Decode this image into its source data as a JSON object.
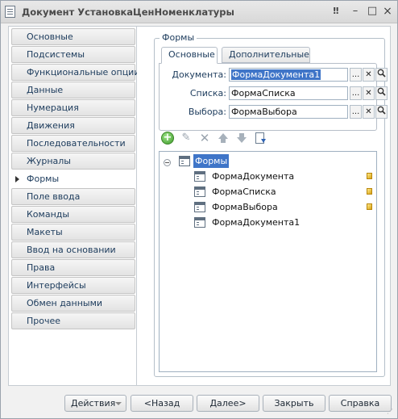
{
  "window": {
    "title": "Документ УстановкаЦенНоменклатуры",
    "buttons": [
      "‼",
      "–",
      "□",
      "×"
    ]
  },
  "sidebar": {
    "active_index": 8,
    "items": [
      {
        "label": "Основные"
      },
      {
        "label": "Подсистемы"
      },
      {
        "label": "Функциональные опции"
      },
      {
        "label": "Данные"
      },
      {
        "label": "Нумерация"
      },
      {
        "label": "Движения"
      },
      {
        "label": "Последовательности"
      },
      {
        "label": "Журналы"
      },
      {
        "label": "Формы"
      },
      {
        "label": "Поле ввода"
      },
      {
        "label": "Команды"
      },
      {
        "label": "Макеты"
      },
      {
        "label": "Ввод на основании"
      },
      {
        "label": "Права"
      },
      {
        "label": "Интерфейсы"
      },
      {
        "label": "Обмен данными"
      },
      {
        "label": "Прочее"
      }
    ]
  },
  "forms_group": {
    "title": "Формы",
    "tabs": [
      {
        "label": "Основные",
        "active": true
      },
      {
        "label": "Дополнительные",
        "active": false
      }
    ],
    "fields": [
      {
        "label": "Документа:",
        "value": "ФормаДокумента1",
        "selected": true
      },
      {
        "label": "Списка:",
        "value": "ФормаСписка",
        "selected": false
      },
      {
        "label": "Выбора:",
        "value": "ФормаВыбора",
        "selected": false
      }
    ],
    "field_buttons": {
      "choose": "...",
      "clear": "✕",
      "open": "search"
    }
  },
  "toolbar": {
    "icons": [
      "add-icon",
      "edit-icon",
      "delete-icon",
      "move-up-icon",
      "move-down-icon",
      "sort-icon"
    ],
    "add_glyph": "+",
    "edit_glyph": "✎",
    "delete_glyph": "✕"
  },
  "tree": {
    "root_label": "Формы",
    "items": [
      {
        "label": "ФормаДокумента",
        "marker": true
      },
      {
        "label": "ФормаСписка",
        "marker": true
      },
      {
        "label": "ФормаВыбора",
        "marker": true
      },
      {
        "label": "ФормаДокумента1",
        "marker": false
      }
    ]
  },
  "footer": {
    "actions_label": "Действия",
    "back_label": "<Назад",
    "next_label": "Далее>",
    "close_label": "Закрыть",
    "help_label": "Справка"
  },
  "colors": {
    "selection": "#3f75c8",
    "add_green": "#3e9a2a",
    "marker_yellow": "#d9a414"
  }
}
